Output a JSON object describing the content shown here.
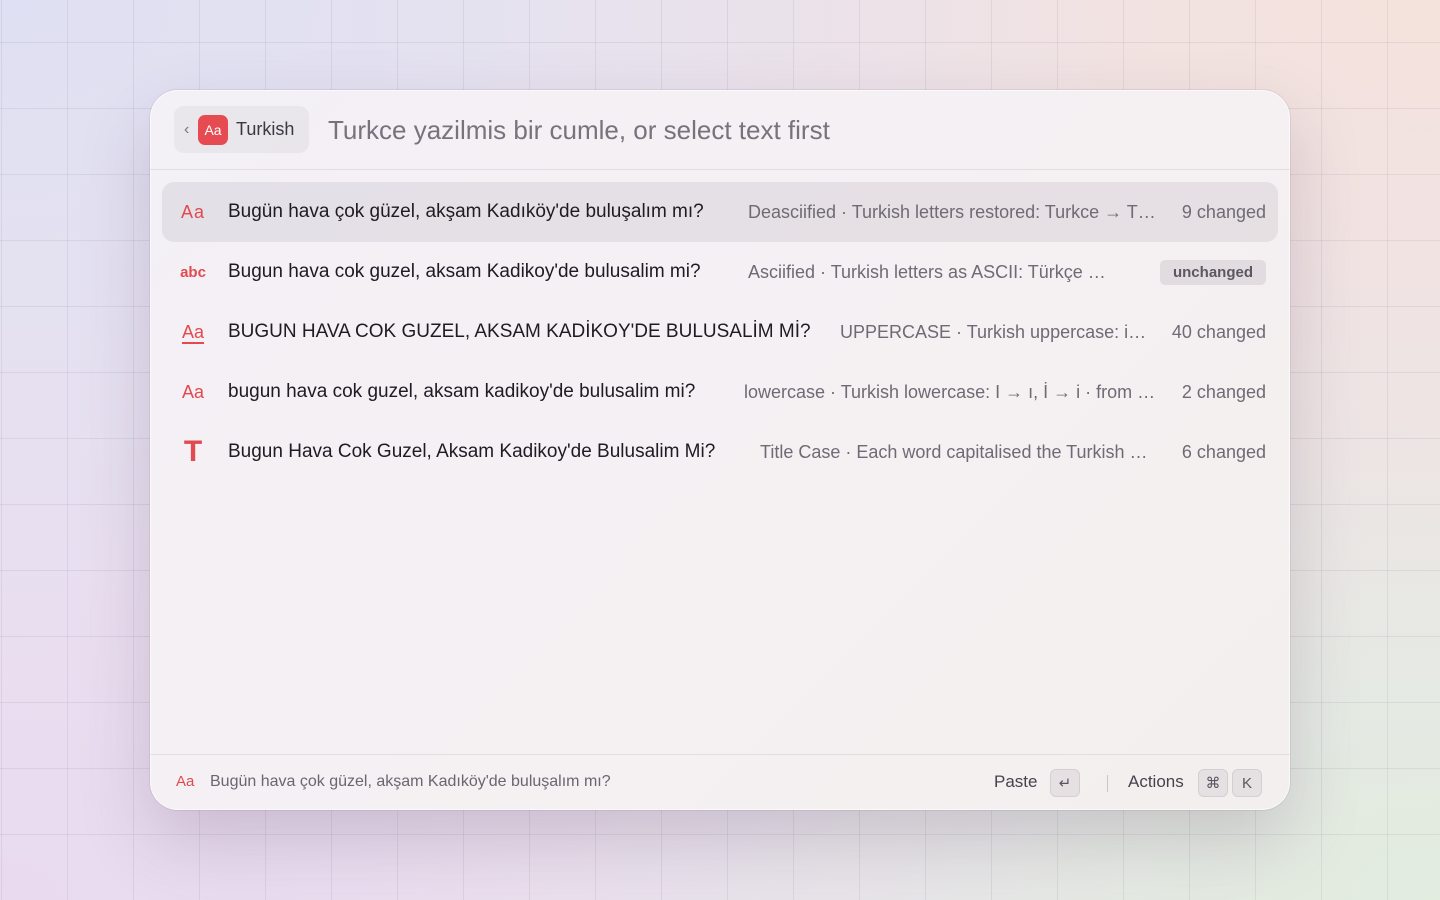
{
  "header": {
    "chip_label": "Turkish",
    "chip_icon_text": "Aa",
    "back_icon": "chevron-left-icon",
    "search_placeholder": "Turkce yazilmis bir cumle, or select text first"
  },
  "results": [
    {
      "icon": "text-case-icon",
      "icon_text": "Aa",
      "title": "Bugün hava çok güzel, akşam Kadıköy'de buluşalım mı?",
      "subtitle": "Deasciified · Turkish letters restored: Turkce → Türkçe",
      "status": "9 changed",
      "selected": true
    },
    {
      "icon": "abc-icon",
      "icon_text": "abc",
      "title": "Bugun hava cok guzel, aksam Kadikoy'de bulusalim mi?",
      "subtitle": "Asciified · Turkish letters as ASCII: Türkçe → Turkce",
      "status": "unchanged",
      "selected": false
    },
    {
      "icon": "uppercase-icon",
      "icon_text": "Aa",
      "title": "BUGUN HAVA COK GUZEL, AKSAM KADİKOY'DE BULUSALİM Mİ?",
      "subtitle": "UPPERCASE · Turkish uppercase: i → İ",
      "status": "40 changed",
      "selected": false
    },
    {
      "icon": "lowercase-icon",
      "icon_text": "Aa",
      "title": "bugun hava cok guzel, aksam kadikoy'de bulusalim mi?",
      "subtitle": "lowercase · Turkish lowercase: I → ı, İ → i · from the input",
      "status": "2 changed",
      "selected": false
    },
    {
      "icon": "title-case-icon",
      "icon_text": "T",
      "title": "Bugun Hava Cok Guzel, Aksam Kadikoy'de Bulusalim Mi?",
      "subtitle": "Title Case · Each word capitalised the Turkish way",
      "status": "6 changed",
      "selected": false
    }
  ],
  "footer": {
    "icon_text": "Aa",
    "preview_text": "Bugün hava çok güzel, akşam Kadıköy'de buluşalım mı?",
    "paste_label": "Paste",
    "paste_key": "↵",
    "actions_label": "Actions",
    "actions_key_1": "⌘",
    "actions_key_2": "K"
  },
  "colors": {
    "accent": "#e54b50",
    "selected_row": "#e3dee6"
  }
}
